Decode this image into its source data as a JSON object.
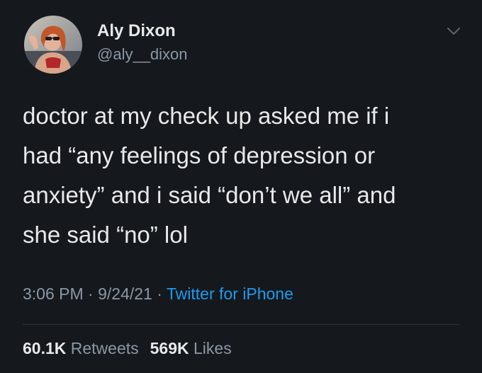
{
  "author": {
    "display_name": "Aly Dixon",
    "handle": "@aly__dixon"
  },
  "tweet": {
    "text": "doctor at my check up asked me if i\nhad “any feelings of depression or\nanxiety” and i said “don’t we all” and\nshe said “no” lol"
  },
  "meta": {
    "time": "3:06 PM",
    "separator": " · ",
    "date": "9/24/21",
    "source": "Twitter for iPhone"
  },
  "stats": {
    "retweets_count": "60.1K",
    "retweets_label": " Retweets",
    "likes_count": "569K",
    "likes_label": " Likes"
  },
  "colors": {
    "background": "#15181c",
    "text": "#e7e9ea",
    "secondary_text": "#8b98a5",
    "link": "#1d9bf0"
  },
  "icons": {
    "menu": "chevron-down-icon"
  }
}
